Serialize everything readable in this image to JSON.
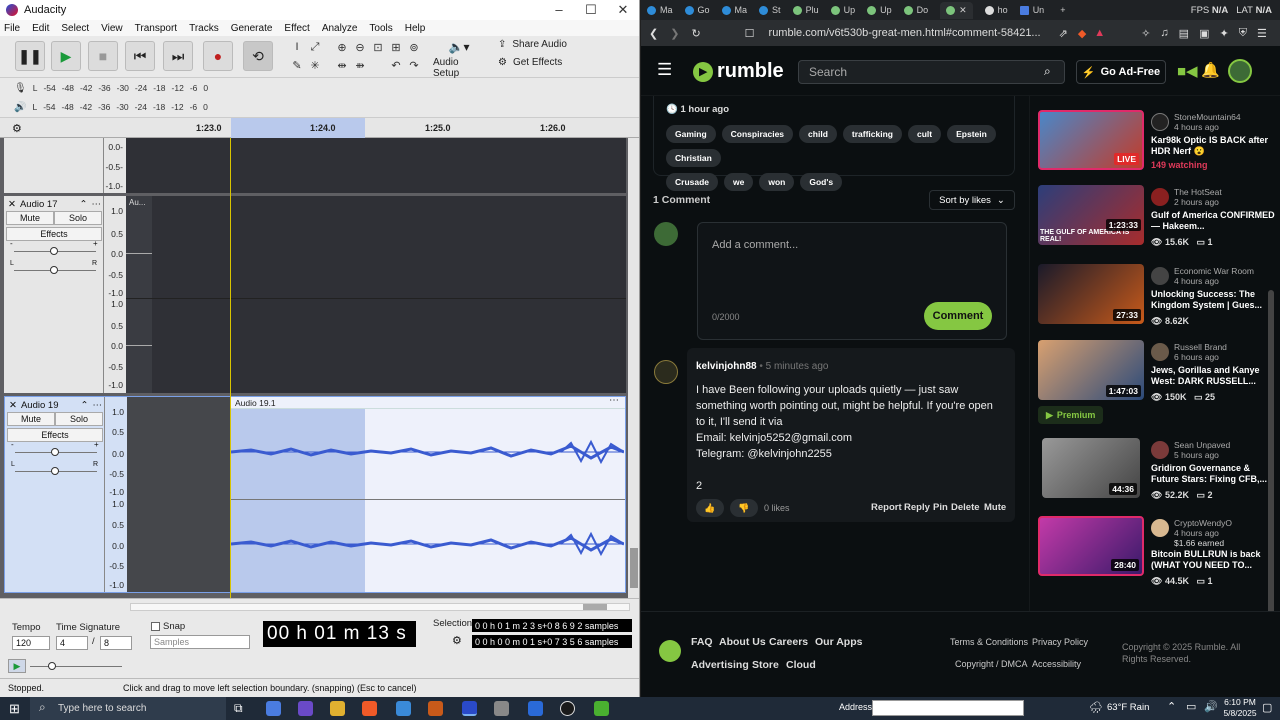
{
  "audacity": {
    "title": "Audacity",
    "menu": [
      "File",
      "Edit",
      "Select",
      "View",
      "Transport",
      "Tracks",
      "Generate",
      "Effect",
      "Analyze",
      "Tools",
      "Help"
    ],
    "audio_setup": "Audio Setup",
    "share_audio": "Share Audio",
    "get_effects": "Get Effects",
    "meter_scale": [
      "-54",
      "-48",
      "-42",
      "-36",
      "-30",
      "-24",
      "-18",
      "-12",
      "-6",
      "0"
    ],
    "ruler": [
      "1:23.0",
      "1:24.0",
      "1:25.0",
      "1:26.0"
    ],
    "scale_labels": [
      "1.0",
      "0.5",
      "0.0",
      "-0.5",
      "-1.0"
    ],
    "top_scale": [
      "0.0-",
      "-0.5-",
      "-1.0-"
    ],
    "track17": {
      "name": "Audio 17",
      "mute": "Mute",
      "solo": "Solo",
      "effects": "Effects",
      "clip": "Au...",
      "lr": [
        "L",
        "R"
      ]
    },
    "track19": {
      "name": "Audio 19",
      "mute": "Mute",
      "solo": "Solo",
      "effects": "Effects",
      "clip": "Audio 19.1",
      "lr": [
        "L",
        "R"
      ]
    },
    "tempo_label": "Tempo",
    "tempo_value": "120",
    "timesig_label": "Time Signature",
    "timesig_num": "4",
    "timesig_den": "8",
    "snap_label": "Snap",
    "snap_value": "Samples",
    "time_display": "00 h 01 m 13 s",
    "selection_label": "Selection",
    "selection_start": "0 0 h 0 1 m 2 3 s+0 8 6 9 2 samples",
    "selection_len": "0 0 h 0 0 m 0 1 s+0 7 3 5 6 samples",
    "status_left": "Stopped.",
    "status_msg": "Click and drag to move left selection boundary. (snapping) (Esc to cancel)"
  },
  "browser": {
    "tabs": [
      "Ma",
      "Go",
      "Ma",
      "St",
      "Plu",
      "Up",
      "Up",
      "Do",
      "",
      "ho",
      "Un"
    ],
    "fps_label": "FPS",
    "fps_value": "N/A",
    "lat_label": "LAT",
    "lat_value": "N/A",
    "url": "rumble.com/v6t530b-great-men.html#comment-58421...",
    "logo": "rumble",
    "search_placeholder": "Search",
    "ad_free": "Go Ad-Free",
    "posted": "1 hour ago",
    "tags": [
      "Gaming",
      "Conspiracies",
      "child",
      "trafficking",
      "cult",
      "Epstein",
      "Christian",
      "Crusade",
      "we",
      "won",
      "God's"
    ],
    "comment_count": "1 Comment",
    "sort": "Sort by likes",
    "add_comment": "Add a comment...",
    "char_count": "0/2000",
    "comment_btn": "Comment",
    "comment": {
      "user": "kelvinjohn88",
      "time": "5 minutes ago",
      "lines": [
        "I have Been following your uploads quietly — just saw",
        "something worth pointing out, might be helpful. If you're open",
        "to it, I'll send it via",
        "Email: kelvinjo5252@gmail.com",
        "Telegram: @kelvinjohn2255",
        "",
        "2"
      ],
      "likes": "0 likes",
      "actions": [
        "Report",
        "Reply",
        "Pin",
        "Delete",
        "Mute"
      ]
    },
    "videos": [
      {
        "channel": "StoneMountain64",
        "time": "4 hours ago",
        "title": "Kar98k Optic IS BACK after HDR Nerf 😮",
        "stat": "149 watching",
        "stat2": "",
        "badge": "LIVE",
        "dur": "",
        "color": "#3b6aa8"
      },
      {
        "channel": "The HotSeat",
        "time": "2 hours ago",
        "title": "Gulf of America CONFIRMED — Hakeem...",
        "stat": "15.6K",
        "stat2": "1",
        "badge": "",
        "dur": "1:23:33",
        "thumb_text": "THE GULF OF AMERICA IS REAL!",
        "color": "#a82c2c"
      },
      {
        "channel": "Economic War Room",
        "time": "4 hours ago",
        "title": "Unlocking Success: The Kingdom System | Gues...",
        "stat": "8.62K",
        "stat2": "",
        "badge": "",
        "dur": "27:33",
        "color": "#8a3a1a"
      },
      {
        "channel": "Russell Brand",
        "time": "6 hours ago",
        "title": "Jews, Gorillas and Kanye West: DARK RUSSELL...",
        "stat": "150K",
        "stat2": "25",
        "badge": "",
        "dur": "1:47:03",
        "premium": "Premium",
        "color": "#2b4a7a"
      },
      {
        "channel": "Sean Unpaved",
        "time": "5 hours ago",
        "title": "Gridiron Governance & Future Stars: Fixing CFB,...",
        "stat": "52.2K",
        "stat2": "2",
        "badge": "",
        "dur": "44:36",
        "color": "#777"
      },
      {
        "channel": "CryptoWendyO",
        "time": "4 hours ago",
        "title": "Bitcoin BULLRUN is back (WHAT YOU NEED TO...",
        "stat": "44.5K",
        "stat2": "1",
        "badge": "",
        "dur": "28:40",
        "earned": "$1.66 earned",
        "color": "#9a2a8a"
      }
    ],
    "footer": {
      "links1": [
        "FAQ",
        "About Us",
        "Careers",
        "Our Apps"
      ],
      "links2": [
        "Advertising",
        "Store",
        "Cloud"
      ],
      "links3": [
        "Terms & Conditions",
        "Privacy Policy"
      ],
      "links4": [
        "Copyright / DMCA",
        "Accessibility"
      ],
      "copyright": "Copyright © 2025 Rumble. All Rights Reserved."
    }
  },
  "taskbar": {
    "search": "Type here to search",
    "address_label": "Address",
    "weather": "63°F  Rain",
    "time": "6:10 PM",
    "date": "5/8/2025"
  },
  "colors": {
    "rumble_green": "#85c742",
    "selection": "#b9c9ec",
    "wave": "#3a5bd0"
  }
}
